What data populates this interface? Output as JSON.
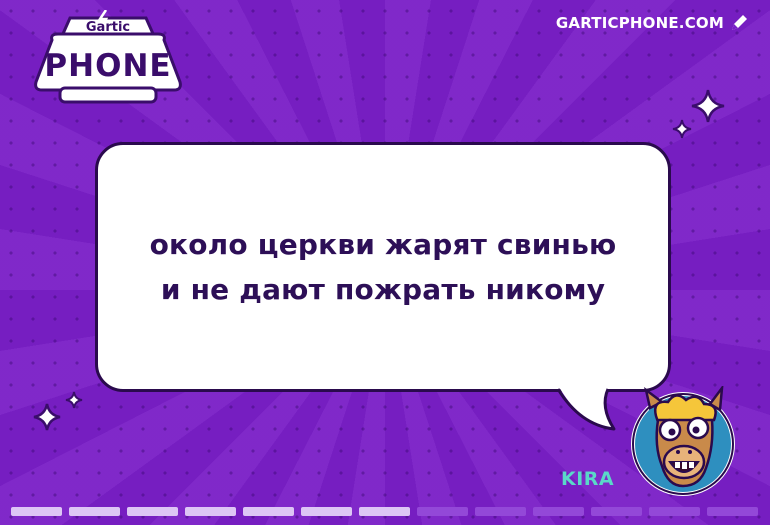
{
  "logo": {
    "top_text": "Gartic",
    "main_text": "PHONE"
  },
  "site_link": {
    "label": "GARTICPHONE.COM",
    "icon": "edit-pencil-icon"
  },
  "bubble": {
    "lines": [
      "около церкви жарят свинью",
      "и не дают пожрать никому"
    ]
  },
  "player": {
    "name": "KIRA",
    "avatar": "llama-avatar"
  },
  "progress": {
    "completed": 7,
    "total": 13
  },
  "colors": {
    "background": "#7a1fc7",
    "bubble_text": "#2d0f57",
    "player_name": "#5ad8c8",
    "progress_done": "#ddc6f5",
    "progress_todo": "#9348d8"
  }
}
